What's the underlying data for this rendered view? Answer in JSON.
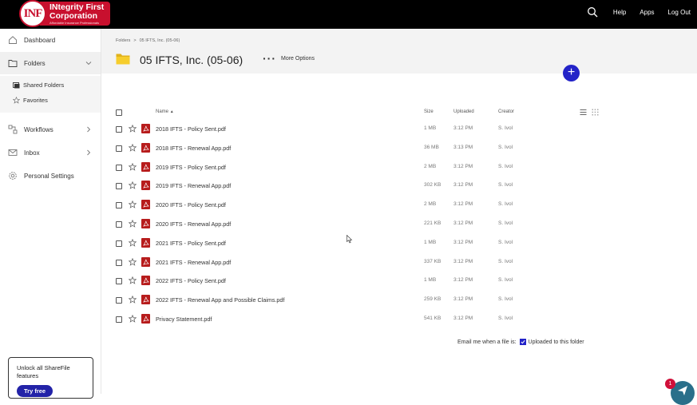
{
  "brand": {
    "logo_initials": "INF",
    "logo_line1": "INtegrity First",
    "logo_line2": "Corporation",
    "logo_tagline": "Affordable Insurance Professionals"
  },
  "topbar": {
    "help": "Help",
    "apps": "Apps",
    "logout": "Log Out",
    "search_icon": "search-icon"
  },
  "sidebar": {
    "items": [
      {
        "label": "Dashboard",
        "icon": "home-icon"
      },
      {
        "label": "Folders",
        "icon": "folder-icon"
      },
      {
        "label": "Workflows",
        "icon": "workflow-icon"
      },
      {
        "label": "Inbox",
        "icon": "mail-icon"
      },
      {
        "label": "Personal Settings",
        "icon": "gear-icon"
      }
    ],
    "sub_items": [
      {
        "label": "Shared Folders",
        "icon": "shared-folders-icon"
      },
      {
        "label": "Favorites",
        "icon": "star-icon"
      }
    ],
    "promo": {
      "text": "Unlock all ShareFile features",
      "button": "Try free"
    }
  },
  "header": {
    "breadcrumb_root": "Folders",
    "breadcrumb_sep": ">",
    "breadcrumb_current": "05 IFTS, Inc. (05-06)",
    "title": "05 IFTS, Inc. (05-06)",
    "more_options": "More Options",
    "add_button": "+"
  },
  "table": {
    "columns": {
      "name": "Name",
      "sort_indicator": "▲",
      "size": "Size",
      "uploaded": "Uploaded",
      "creator": "Creator"
    },
    "rows": [
      {
        "name": "2018 IFTS - Policy Sent.pdf",
        "size": "1 MB",
        "uploaded": "3:12 PM",
        "creator": "S. Ivol"
      },
      {
        "name": "2018 IFTS - Renewal App.pdf",
        "size": "36 MB",
        "uploaded": "3:13 PM",
        "creator": "S. Ivol"
      },
      {
        "name": "2019 IFTS - Policy Sent.pdf",
        "size": "2 MB",
        "uploaded": "3:12 PM",
        "creator": "S. Ivol"
      },
      {
        "name": "2019 IFTS - Renewal App.pdf",
        "size": "302 KB",
        "uploaded": "3:12 PM",
        "creator": "S. Ivol"
      },
      {
        "name": "2020 IFTS - Policy Sent.pdf",
        "size": "2 MB",
        "uploaded": "3:12 PM",
        "creator": "S. Ivol"
      },
      {
        "name": "2020 IFTS - Renewal App.pdf",
        "size": "221 KB",
        "uploaded": "3:12 PM",
        "creator": "S. Ivol"
      },
      {
        "name": "2021 IFTS - Policy Sent.pdf",
        "size": "1 MB",
        "uploaded": "3:12 PM",
        "creator": "S. Ivol"
      },
      {
        "name": "2021 IFTS - Renewal App.pdf",
        "size": "337 KB",
        "uploaded": "3:12 PM",
        "creator": "S. Ivol"
      },
      {
        "name": "2022 IFTS - Policy Sent.pdf",
        "size": "1 MB",
        "uploaded": "3:12 PM",
        "creator": "S. Ivol"
      },
      {
        "name": "2022 IFTS - Renewal App and Possible Claims.pdf",
        "size": "259 KB",
        "uploaded": "3:12 PM",
        "creator": "S. Ivol"
      },
      {
        "name": "Privacy Statement.pdf",
        "size": "541 KB",
        "uploaded": "3:12 PM",
        "creator": "S. Ivol"
      }
    ]
  },
  "footer": {
    "email_label": "Email me when a file is:",
    "email_option": "Uploaded to this folder"
  },
  "chat": {
    "badge": "1"
  },
  "colors": {
    "topbar": "#000000",
    "brand_red": "#c8102e",
    "accent_blue": "#2323c8",
    "pdf_red": "#b71c1c"
  }
}
